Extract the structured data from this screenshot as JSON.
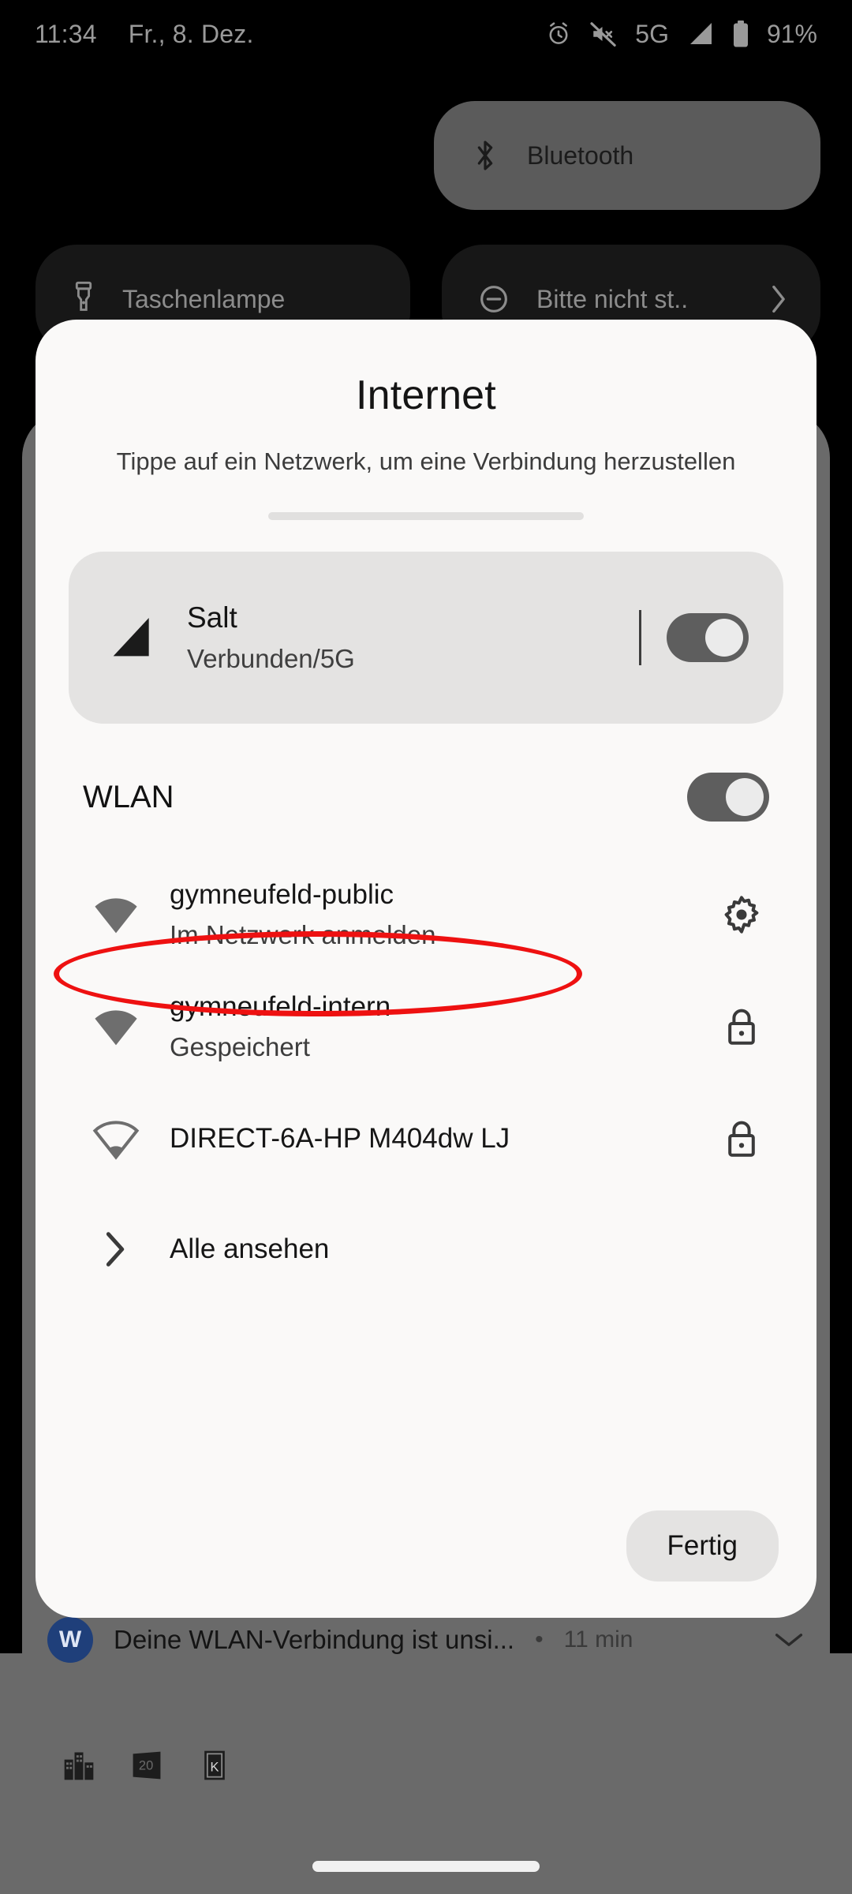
{
  "status_bar": {
    "time": "11:34",
    "date": "Fr., 8. Dez.",
    "network_type": "5G",
    "battery_percent": "91%",
    "icons": [
      "alarm-icon",
      "mute-icon",
      "signal-icon",
      "battery-icon"
    ]
  },
  "quick_settings": {
    "tiles": [
      {
        "label": "Bluetooth",
        "icon": "bluetooth-icon",
        "active": true
      },
      {
        "label": "Taschenlampe",
        "icon": "flashlight-icon",
        "active": false
      },
      {
        "label": "Bitte nicht st..",
        "icon": "do-not-disturb-icon",
        "active": false,
        "has_chevron": true
      }
    ]
  },
  "dialog": {
    "title": "Internet",
    "subtitle": "Tippe auf ein Netzwerk, um eine Verbindung herzustellen",
    "carrier": {
      "name": "Salt",
      "status": "Verbunden/5G",
      "icon": "signal-bars-icon",
      "toggle_on": true
    },
    "wifi_section": {
      "label": "WLAN",
      "toggle_on": true
    },
    "networks": [
      {
        "name": "gymneufeld-public",
        "sub": "Im Netzwerk anmelden",
        "icon": "wifi-full-icon",
        "trailing_icon": "gear-icon",
        "annotated": true
      },
      {
        "name": "gymneufeld-intern",
        "sub": "Gespeichert",
        "icon": "wifi-full-icon",
        "trailing_icon": "lock-icon",
        "annotated": false
      },
      {
        "name": "DIRECT-6A-HP M404dw LJ",
        "sub": "",
        "icon": "wifi-weak-icon",
        "trailing_icon": "lock-icon",
        "annotated": false
      }
    ],
    "see_all": {
      "label": "Alle ansehen",
      "icon": "chevron-right-icon"
    },
    "done_button": "Fertig"
  },
  "notification": {
    "text": "Deine WLAN-Verbindung ist unsi...",
    "separator": "•",
    "time": "11 min",
    "app_icon_letter": "W",
    "expand_icon": "chevron-down-icon"
  },
  "app_icons": [
    "buildings-icon",
    "20-minuten-icon",
    "k-icon"
  ],
  "colors": {
    "annotation_red": "#ee1111",
    "dialog_bg": "#faf9f8",
    "scrim": "#6a6a6a",
    "tile_active": "#5b5b5b",
    "tile_inactive": "#171717"
  }
}
